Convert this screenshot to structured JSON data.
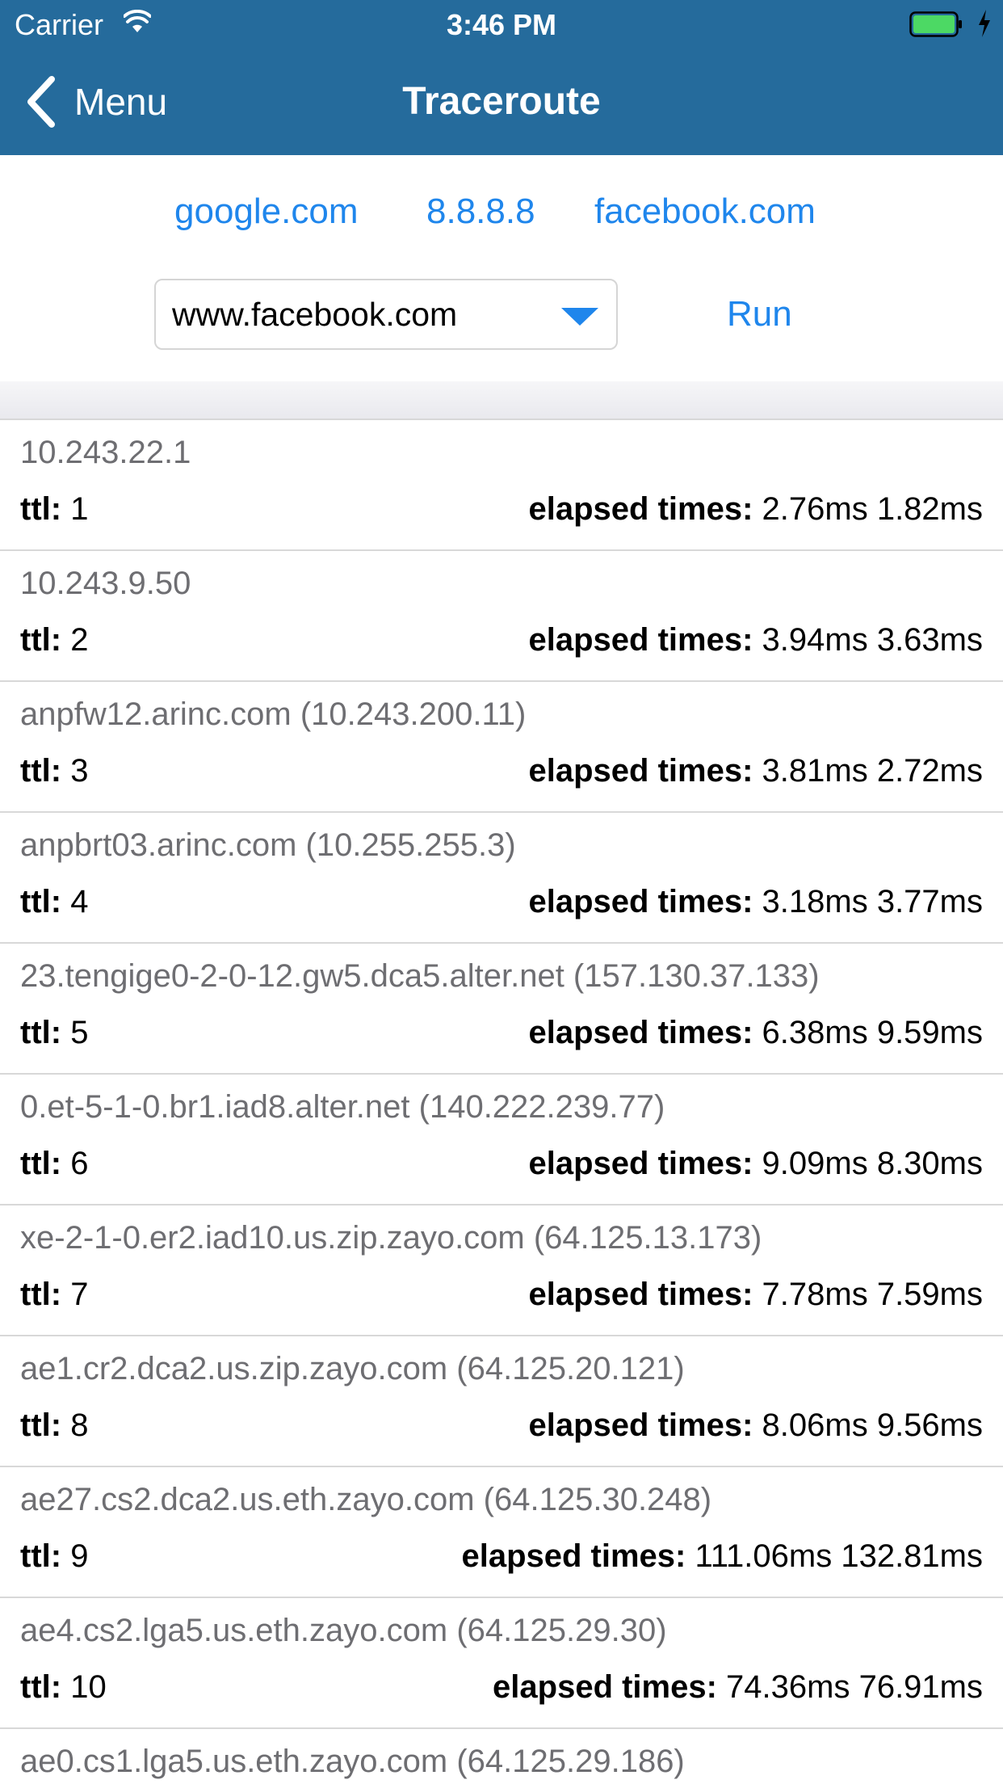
{
  "status_bar": {
    "carrier": "Carrier",
    "time": "3:46 PM",
    "icons": [
      "wifi-icon",
      "battery-icon",
      "charging-bolt-icon"
    ],
    "battery_color": "#4cd964"
  },
  "nav": {
    "back_label": "Menu",
    "title": "Traceroute",
    "background_color": "#256b9c"
  },
  "quick_links": [
    "google.com",
    "8.8.8.8",
    "facebook.com"
  ],
  "host_select": {
    "value": "www.facebook.com"
  },
  "run_label": "Run",
  "accent_color": "#1f86ec",
  "labels": {
    "ttl": "ttl:",
    "elapsed": "elapsed times:"
  },
  "hops": [
    {
      "host": "10.243.22.1",
      "ttl": "1",
      "times": "2.76ms 1.82ms"
    },
    {
      "host": "10.243.9.50",
      "ttl": "2",
      "times": "3.94ms 3.63ms"
    },
    {
      "host": "anpfw12.arinc.com (10.243.200.11)",
      "ttl": "3",
      "times": "3.81ms 2.72ms"
    },
    {
      "host": "anpbrt03.arinc.com (10.255.255.3)",
      "ttl": "4",
      "times": "3.18ms 3.77ms"
    },
    {
      "host": "23.tengige0-2-0-12.gw5.dca5.alter.net (157.130.37.133)",
      "ttl": "5",
      "times": "6.38ms 9.59ms"
    },
    {
      "host": "0.et-5-1-0.br1.iad8.alter.net (140.222.239.77)",
      "ttl": "6",
      "times": "9.09ms 8.30ms"
    },
    {
      "host": "xe-2-1-0.er2.iad10.us.zip.zayo.com (64.125.13.173)",
      "ttl": "7",
      "times": "7.78ms 7.59ms"
    },
    {
      "host": "ae1.cr2.dca2.us.zip.zayo.com (64.125.20.121)",
      "ttl": "8",
      "times": "8.06ms 9.56ms"
    },
    {
      "host": "ae27.cs2.dca2.us.eth.zayo.com (64.125.30.248)",
      "ttl": "9",
      "times": "111.06ms 132.81ms"
    },
    {
      "host": "ae4.cs2.lga5.us.eth.zayo.com (64.125.29.30)",
      "ttl": "10",
      "times": "74.36ms 76.91ms"
    },
    {
      "host": "ae0.cs1.lga5.us.eth.zayo.com (64.125.29.186)",
      "ttl": "",
      "times": ""
    }
  ]
}
